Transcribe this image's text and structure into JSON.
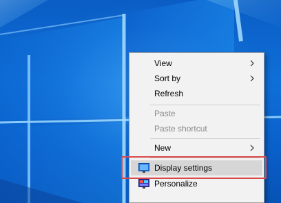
{
  "desktop": {
    "wallpaper": "windows-10-hero-blue",
    "colors": {
      "background": "#0a5dc4",
      "light_beam": "#8fd0ff"
    }
  },
  "context_menu": {
    "items": [
      {
        "label": "View",
        "has_submenu": true,
        "enabled": true
      },
      {
        "label": "Sort by",
        "has_submenu": true,
        "enabled": true
      },
      {
        "label": "Refresh",
        "has_submenu": false,
        "enabled": true
      },
      {
        "label": "Paste",
        "has_submenu": false,
        "enabled": false
      },
      {
        "label": "Paste shortcut",
        "has_submenu": false,
        "enabled": false
      },
      {
        "label": "New",
        "has_submenu": true,
        "enabled": true
      },
      {
        "label": "Display settings",
        "has_submenu": false,
        "enabled": true,
        "icon": "display-icon",
        "highlighted": true
      },
      {
        "label": "Personalize",
        "has_submenu": false,
        "enabled": true,
        "icon": "personalize-icon"
      }
    ],
    "colors": {
      "background": "#f2f2f2",
      "highlight": "#d6d6d6",
      "disabled_text": "#8a8a8a"
    }
  },
  "annotation": {
    "target": "Display settings",
    "color": "#d94a4a"
  }
}
